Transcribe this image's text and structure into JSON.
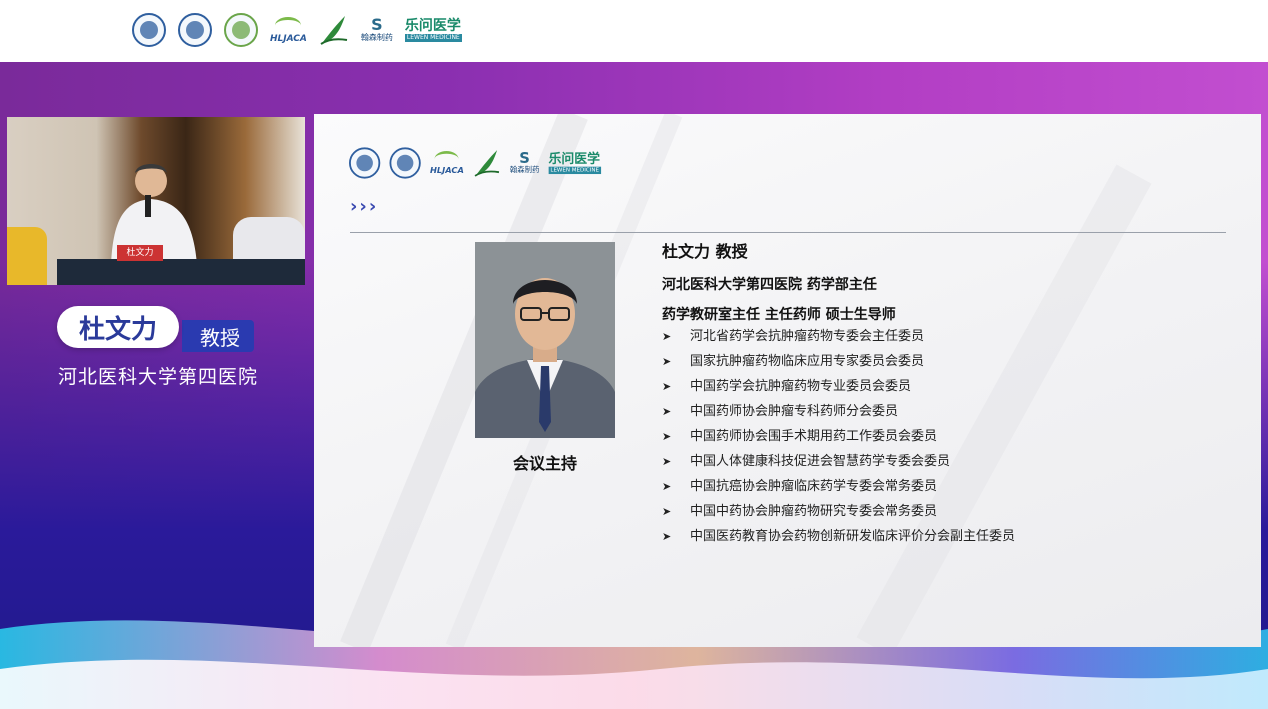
{
  "speaker": {
    "name": "杜文力",
    "title": "教授",
    "affiliation": "河北医科大学第四医院",
    "nameplate": "杜文力"
  },
  "logos": {
    "hljaca_text": "HLJACA",
    "hs_name": "翰森制药",
    "lw_name": "乐问医学",
    "lw_en": "LEWEN MEDICINE"
  },
  "slide": {
    "name_line": "杜文力 教授",
    "position_line": "河北医科大学第四医院  药学部主任",
    "role_line": "药学教研室主任  主任药师  硕士生导师",
    "photo_caption": "会议主持",
    "memberships": [
      "河北省药学会抗肿瘤药物专委会主任委员",
      "国家抗肿瘤药物临床应用专家委员会委员",
      "中国药学会抗肿瘤药物专业委员会委员",
      "中国药师协会肿瘤专科药师分会委员",
      "中国药师协会围手术期用药工作委员会委员",
      "中国人体健康科技促进会智慧药学专委会委员",
      "中国抗癌协会肿瘤临床药学专委会常务委员",
      "中国中药协会肿瘤药物研究专委会常务委员",
      "中国医药教育协会药物创新研发临床评价分会副主任委员"
    ]
  },
  "colors": {
    "accent_blue": "#2a3ab0",
    "stage_purple": "#8a2fb0"
  }
}
